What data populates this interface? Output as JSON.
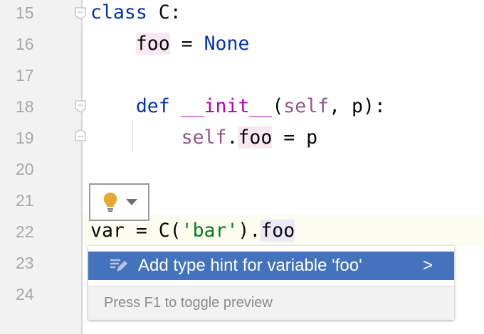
{
  "gutter": {
    "line_numbers": [
      "15",
      "16",
      "17",
      "18",
      "19",
      "20",
      "21",
      "22",
      "23",
      "24"
    ]
  },
  "code": {
    "l15": {
      "kw": "class",
      "rest": " C:"
    },
    "l16": {
      "var": "foo",
      "eq": " = ",
      "val": "None"
    },
    "l18": {
      "kw": "def",
      "fn": "__init__",
      "p1": "(",
      "self": "self",
      "p2": ", p):"
    },
    "l19": {
      "self": "self",
      "dot": ".",
      "attr": "foo",
      "rest": " = p"
    },
    "l22": {
      "a": "var = C(",
      "str": "'bar'",
      "b": ").",
      "attr": "foo"
    }
  },
  "intention": {
    "icon": "lightbulb-icon"
  },
  "popup": {
    "item": "Add type hint for variable 'foo'",
    "arrow": ">",
    "footer": "Press F1 to toggle preview"
  },
  "colors": {
    "selection": "#4373bd",
    "keyword": "#0033b3",
    "bulb": "#e5a831"
  }
}
